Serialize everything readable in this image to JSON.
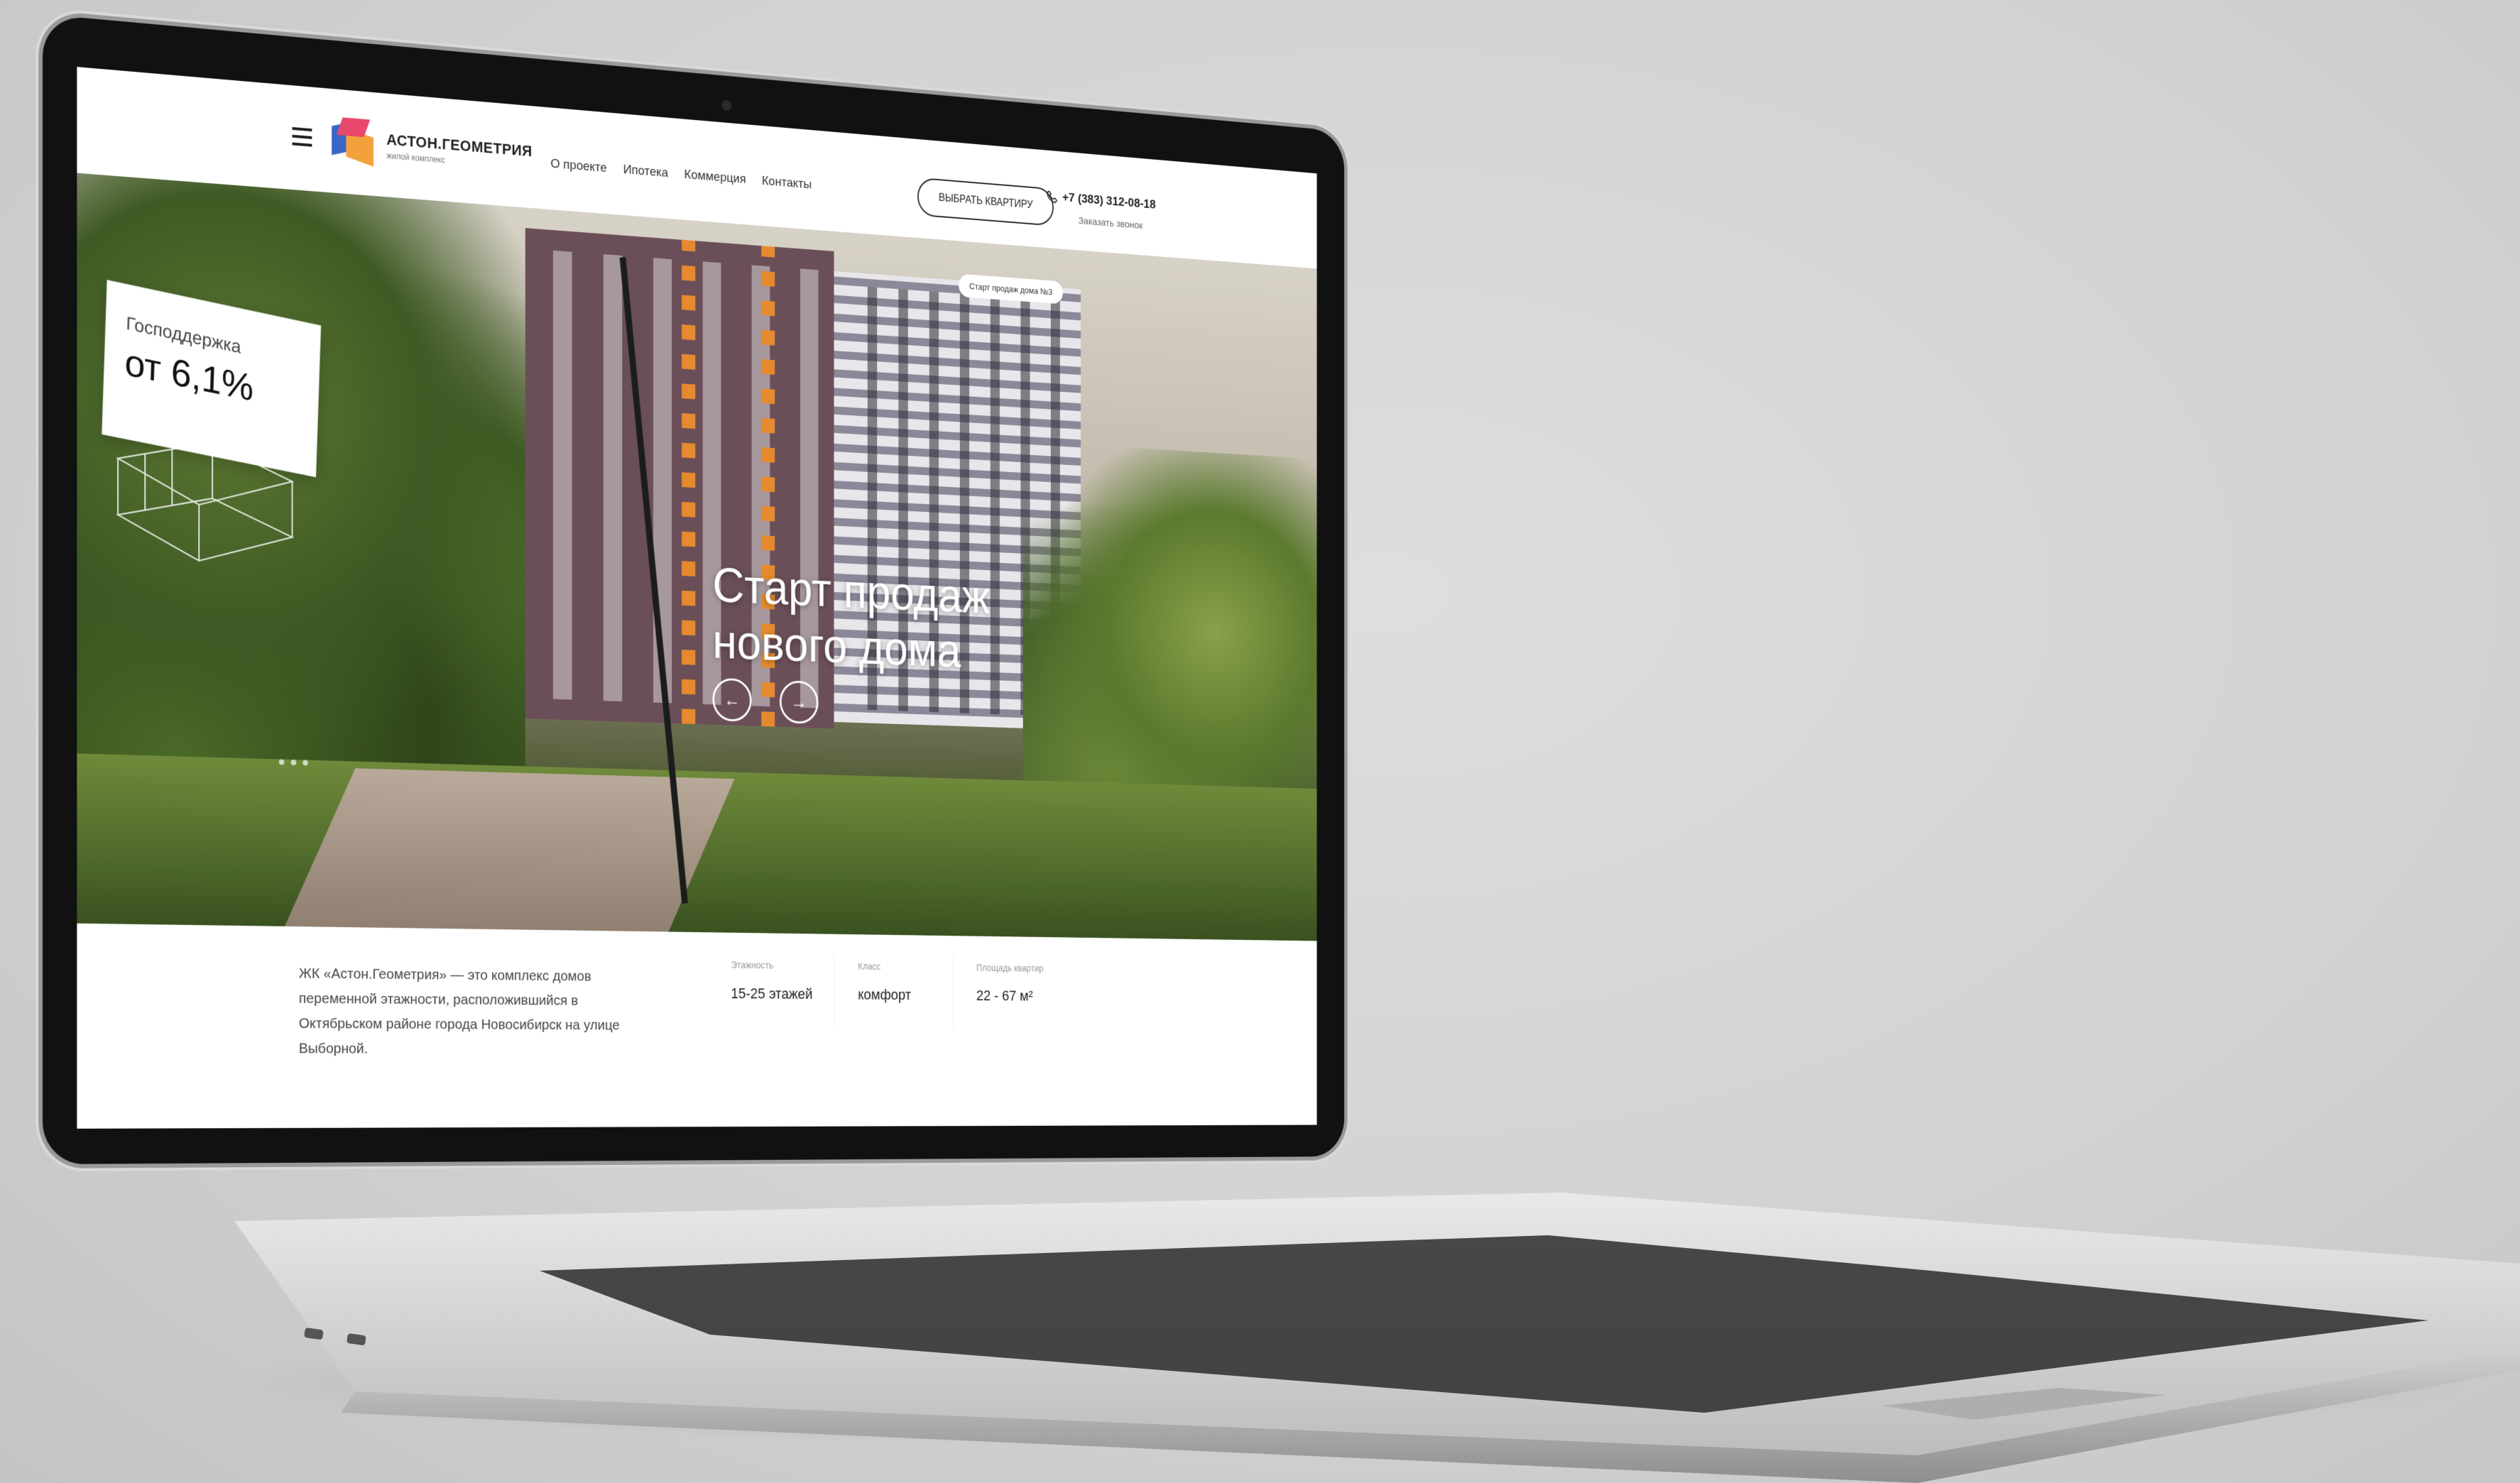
{
  "header": {
    "logo_name": "АСТОН.ГЕОМЕТРИЯ",
    "logo_sub": "жилой комплекс",
    "nav": [
      "О проекте",
      "Ипотека",
      "Коммерция",
      "Контакты"
    ],
    "choose_button": "ВЫБРАТЬ КВАРТИРУ",
    "phone": "+7 (383) 312-08-18",
    "callback": "Заказать звонок"
  },
  "hero": {
    "badge": "Старт продаж дома №3",
    "promo_label": "Господдержка",
    "promo_value": "от 6,1%",
    "title": "Старт продаж нового дома",
    "prev_arrow": "←",
    "next_arrow": "→"
  },
  "info": {
    "description": "ЖК «Астон.Геометрия» — это комплекс домов переменной этажности, расположившийся в Октябрьском районе города Новосибирск на улице Выборной.",
    "stats": [
      {
        "label": "Этажность",
        "value": "15-25 этажей"
      },
      {
        "label": "Класс",
        "value": "комфорт"
      },
      {
        "label": "Площадь квартир",
        "value": "22 - 67 м²"
      }
    ]
  },
  "colors": {
    "logo_blue": "#3a66c8",
    "logo_orange": "#f3a23b",
    "logo_pink": "#e8486b",
    "accent_facade": "#e58a2f"
  }
}
